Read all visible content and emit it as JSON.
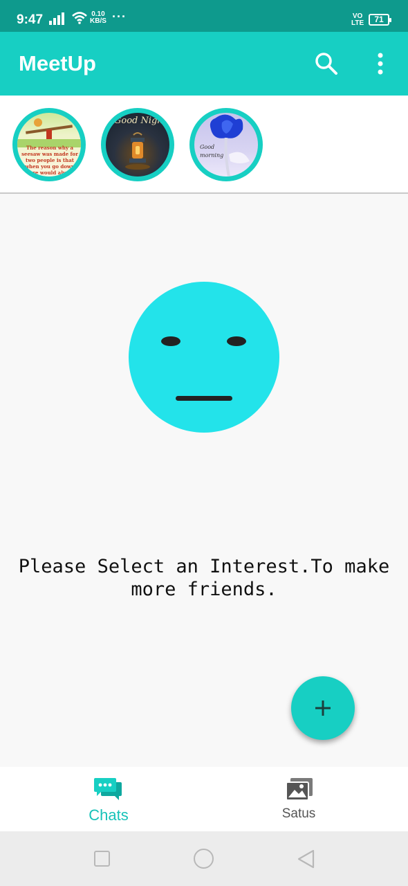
{
  "status_bar": {
    "time": "9:47",
    "network_speed_value": "0.10",
    "network_speed_unit": "KB/S",
    "overflow": "···",
    "volte_top": "VO",
    "volte_bottom": "LTE",
    "battery": "71"
  },
  "app_bar": {
    "title": "MeetUp",
    "search_icon": "search-icon",
    "more_icon": "more-vert-icon"
  },
  "stories": [
    {
      "icon": "story-thumbnail",
      "caption": "The reason why a seesaw was made for two people is that when you go down there would always be someone"
    },
    {
      "icon": "story-thumbnail",
      "caption": "Good Night"
    },
    {
      "icon": "story-thumbnail",
      "caption": "Good morning"
    }
  ],
  "empty_state": {
    "icon": "neutral-face-icon",
    "message": "Please Select an Interest.To make more friends."
  },
  "fab": {
    "icon": "plus-icon"
  },
  "bottom_nav": {
    "items": [
      {
        "label": "Chats",
        "icon": "chat-bubbles-icon",
        "active": true
      },
      {
        "label": "Satus",
        "icon": "images-icon",
        "active": false
      }
    ]
  },
  "colors": {
    "status_bar": "#0e9a8d",
    "primary": "#17cfc3",
    "face": "#23e3ea",
    "active_nav": "#17c2b8"
  }
}
